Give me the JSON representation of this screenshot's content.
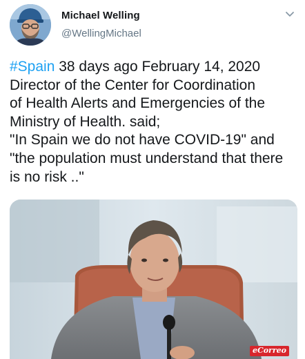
{
  "user": {
    "display_name": "Michael Welling",
    "handle": "@WellingMichael"
  },
  "tweet": {
    "hashtag": "#Spain",
    "text_after_hashtag": "  38 days ago February 14, 2020\nDirector of the Center for Coordination\nof Health Alerts and Emergencies of the\nMinistry of Health. said;\n \"In Spain we do not have COVID-19\" and\n\"the population must understand that there\nis no risk ..\""
  },
  "media": {
    "watermark": "eCorreo"
  },
  "icons": {
    "avatar": "profile-photo",
    "menu": "chevron-down-icon"
  },
  "colors": {
    "link": "#1da1f2",
    "handle": "#657786",
    "text": "#14171a"
  }
}
